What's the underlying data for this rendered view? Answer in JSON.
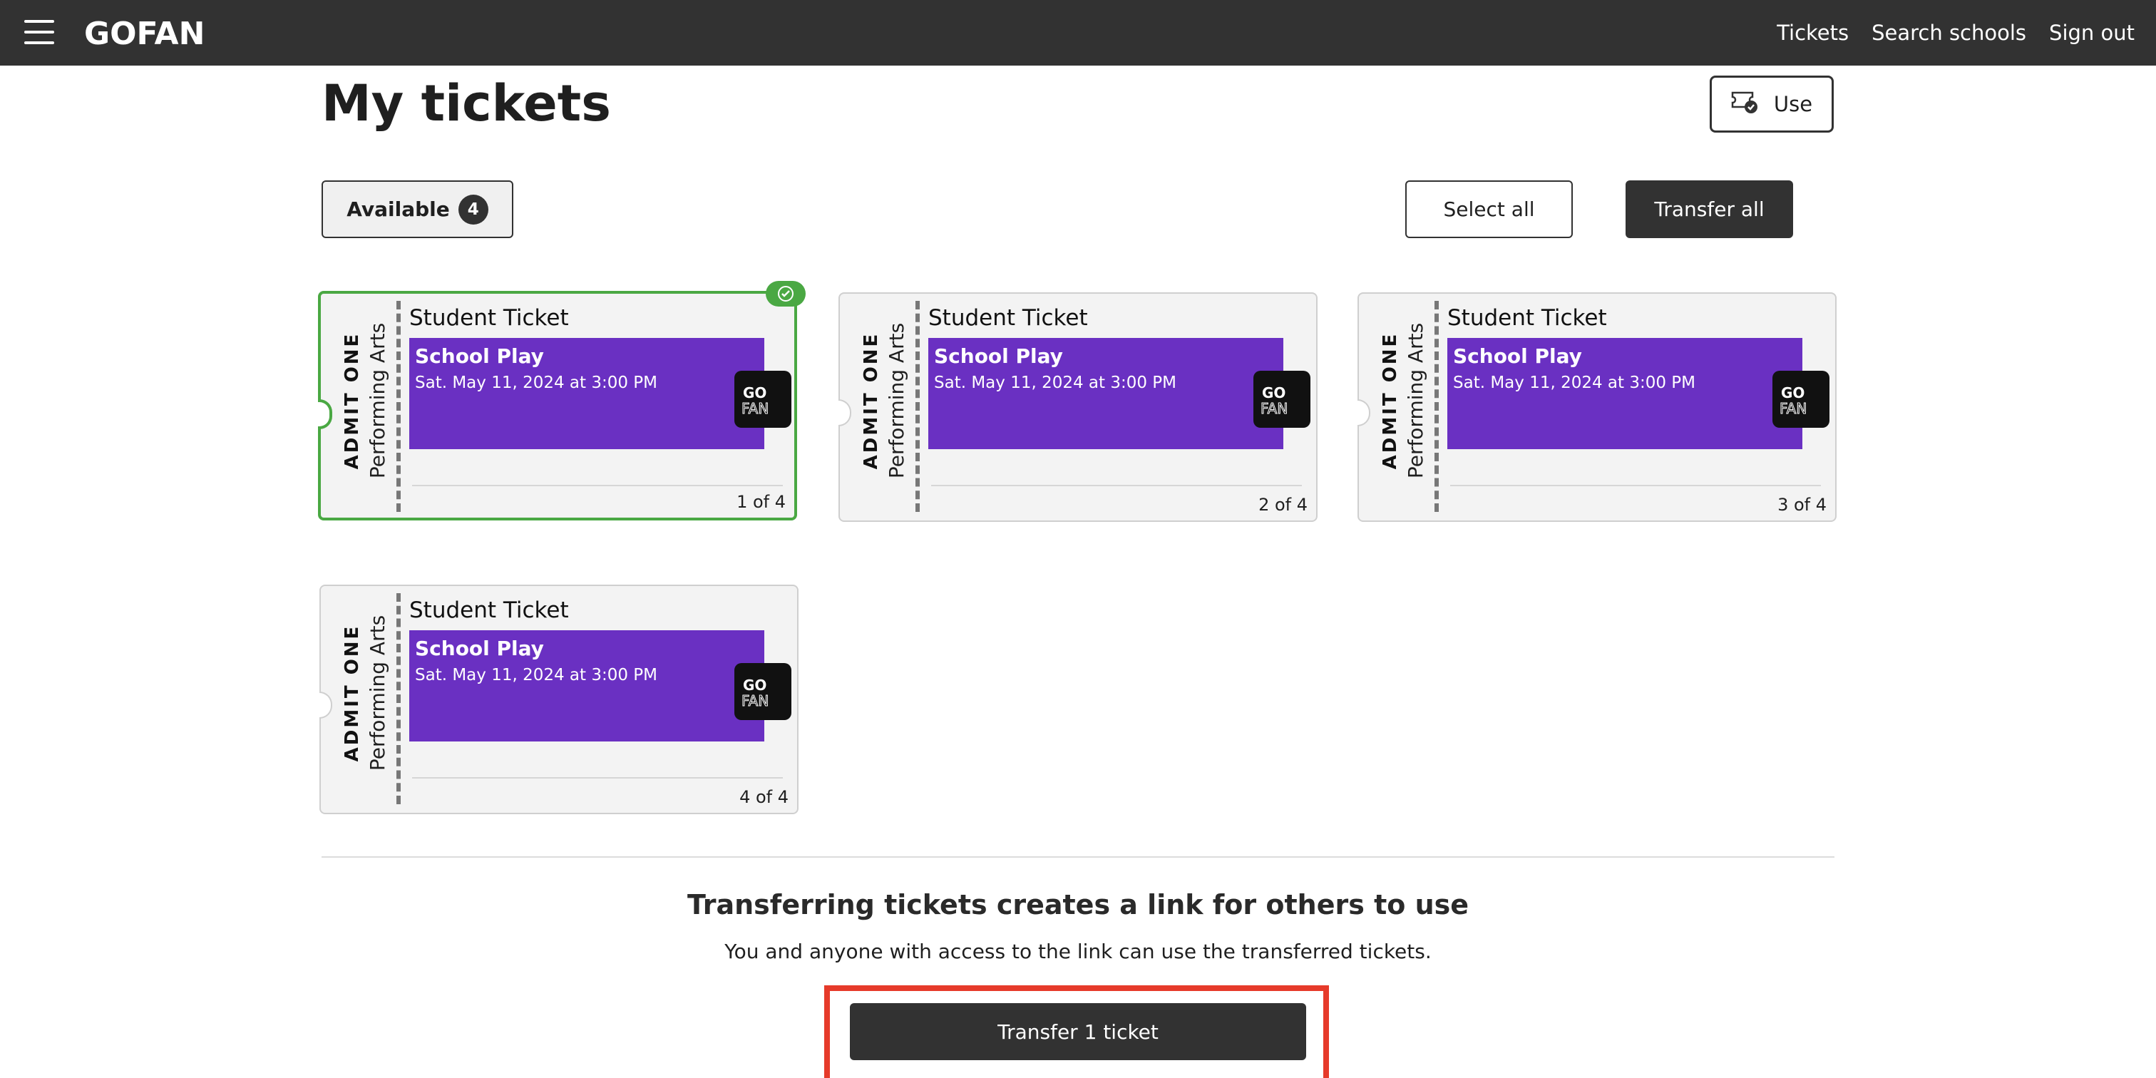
{
  "nav": {
    "menu_icon": "hamburger-menu-icon",
    "logo_text": "GOFAN",
    "links": [
      "Tickets",
      "Search schools",
      "Sign out"
    ]
  },
  "header": {
    "title": "My tickets",
    "use_button_label": "Use"
  },
  "filters": {
    "available_label": "Available",
    "available_count": "4",
    "select_all_label": "Select all",
    "transfer_all_label": "Transfer all"
  },
  "tickets": [
    {
      "admit": "ADMIT ONE",
      "category": "Performing Arts",
      "type": "Student Ticket",
      "event": "School Play",
      "date": "Sat. May 11, 2024 at 3:00 PM",
      "count": "1 of 4",
      "selected": true
    },
    {
      "admit": "ADMIT ONE",
      "category": "Performing Arts",
      "type": "Student Ticket",
      "event": "School Play",
      "date": "Sat. May 11, 2024 at 3:00 PM",
      "count": "2 of 4",
      "selected": false
    },
    {
      "admit": "ADMIT ONE",
      "category": "Performing Arts",
      "type": "Student Ticket",
      "event": "School Play",
      "date": "Sat. May 11, 2024 at 3:00 PM",
      "count": "3 of 4",
      "selected": false
    },
    {
      "admit": "ADMIT ONE",
      "category": "Performing Arts",
      "type": "Student Ticket",
      "event": "School Play",
      "date": "Sat. May 11, 2024 at 3:00 PM",
      "count": "4 of 4",
      "selected": false
    }
  ],
  "footer": {
    "title": "Transferring tickets creates a link for others to use",
    "subtitle": "You and anyone with access to the link can use the transferred tickets.",
    "transfer_button_label": "Transfer 1 ticket"
  },
  "colors": {
    "nav_bg": "#323232",
    "event_card": "#6a30c2",
    "selected_border": "#4aa843",
    "highlight": "#e63a2a"
  }
}
